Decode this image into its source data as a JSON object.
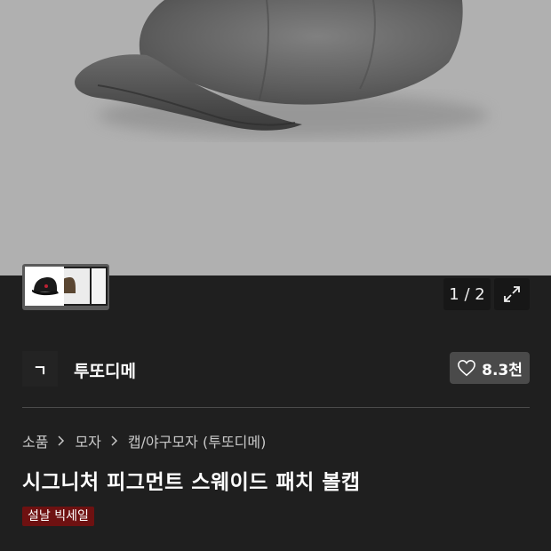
{
  "gallery": {
    "counter": "1 / 2",
    "main_image": "baseball-cap-photo",
    "thumbnail_count": 3
  },
  "brand": {
    "logo_text": "ㄱ",
    "name": "투또디메",
    "likes": "8.3천"
  },
  "breadcrumb": [
    "소품",
    "모자",
    "캡/야구모자 (투또디메)"
  ],
  "product": {
    "title": "시그니처 피그먼트 스웨이드 패치 볼캡",
    "badge": "설날 빅세일"
  },
  "colors": {
    "background": "#1f1f1f",
    "badge": "#6e1111",
    "like_button": "#4a4a4a"
  },
  "icons": [
    "chevron-right-icon",
    "expand-icon",
    "heart-icon"
  ]
}
